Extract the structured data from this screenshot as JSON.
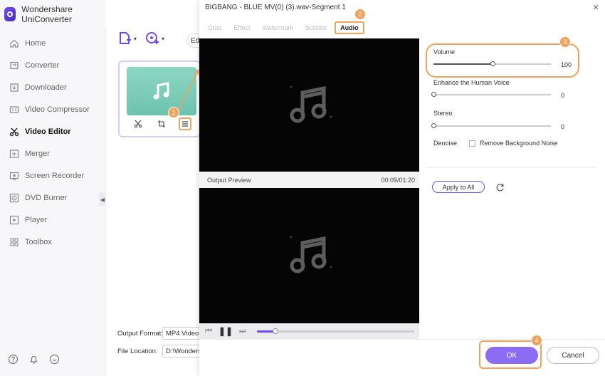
{
  "app": {
    "name": "Wondershare UniConverter"
  },
  "sidebar": {
    "items": [
      {
        "label": "Home",
        "icon": "home-icon",
        "active": false
      },
      {
        "label": "Converter",
        "icon": "converter-icon",
        "active": false
      },
      {
        "label": "Downloader",
        "icon": "downloader-icon",
        "active": false
      },
      {
        "label": "Video Compressor",
        "icon": "video-compressor-icon",
        "active": false
      },
      {
        "label": "Video Editor",
        "icon": "scissors-icon",
        "active": true
      },
      {
        "label": "Merger",
        "icon": "merger-icon",
        "active": false
      },
      {
        "label": "Screen Recorder",
        "icon": "screen-recorder-icon",
        "active": false
      },
      {
        "label": "DVD Burner",
        "icon": "dvd-burner-icon",
        "active": false
      },
      {
        "label": "Player",
        "icon": "player-icon",
        "active": false
      },
      {
        "label": "Toolbox",
        "icon": "toolbox-icon",
        "active": false
      }
    ],
    "footer_icons": [
      "help-icon",
      "notification-icon",
      "feedback-icon"
    ]
  },
  "main": {
    "edit_tab_label": "Edi",
    "output_format_label": "Output Format:",
    "output_format_value": "MP4 Video",
    "file_location_label": "File Location:",
    "file_location_value": "D:\\Wonders"
  },
  "dialog": {
    "title": "BIGBANG - BLUE MV(0) (3).wav-Segment 1",
    "tabs": [
      {
        "label": "Crop",
        "active": false
      },
      {
        "label": "Effect",
        "active": false
      },
      {
        "label": "Watermark",
        "active": false
      },
      {
        "label": "Subtitle",
        "active": false
      },
      {
        "label": "Audio",
        "active": true
      }
    ],
    "output_preview_label": "Output Preview",
    "time_display": "00:09/01:20",
    "playback_progress": 0.12,
    "settings": {
      "volume": {
        "label": "Volume",
        "value": "100",
        "fraction": 0.5
      },
      "enhance": {
        "label": "Enhance the Human Voice",
        "value": "0",
        "fraction": 0.0
      },
      "stereo": {
        "label": "Stereo",
        "value": "0",
        "fraction": 0.0
      },
      "denoise_label": "Denoise",
      "remove_noise_label": "Remove Background Noise"
    },
    "apply_all_label": "Apply to All",
    "ok_label": "OK",
    "cancel_label": "Cancel"
  },
  "steps": [
    "1",
    "2",
    "3",
    "4"
  ],
  "colors": {
    "accent": "#6f4cf0",
    "highlight": "#f0a35c",
    "ok_button": "#8b6cf3"
  }
}
